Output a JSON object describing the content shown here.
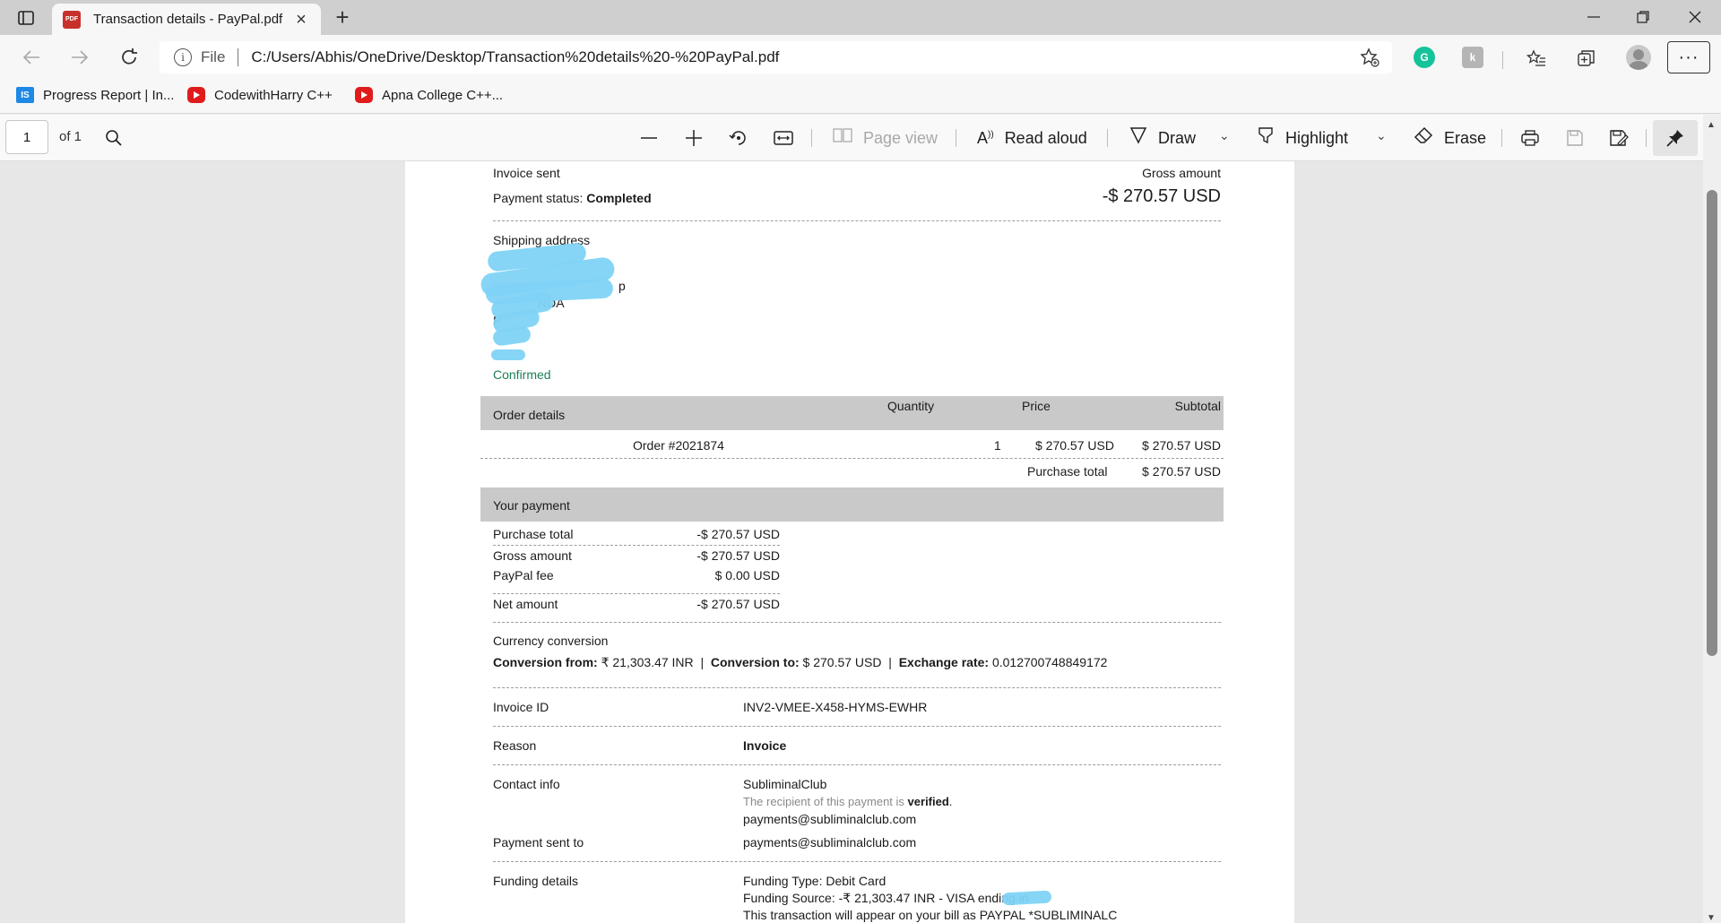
{
  "browser": {
    "tab_title": "Transaction details - PayPal.pdf",
    "tab_badge": "PDF",
    "address_scheme": "File",
    "url": "C:/Users/Abhis/OneDrive/Desktop/Transaction%20details%20-%20PayPal.pdf",
    "favorites": [
      {
        "label": "Progress Report | In...",
        "icon": "IS"
      },
      {
        "label": "CodewithHarry C++",
        "icon": "youtube"
      },
      {
        "label": "Apna College C++...",
        "icon": "youtube"
      }
    ]
  },
  "pdf_toolbar": {
    "page_number": "1",
    "page_of": "of 1",
    "page_view": "Page view",
    "read_aloud": "Read aloud",
    "draw": "Draw",
    "highlight": "Highlight",
    "erase": "Erase"
  },
  "document": {
    "invoice_sent": "Invoice sent",
    "gross_amount_label": "Gross amount",
    "payment_status_label": "Payment status:",
    "payment_status_value": "Completed",
    "gross_amount_value": "-$ 270.57 USD",
    "shipping_address_label": "Shipping address",
    "shipping_partial_1": "NDA",
    "shipping_partial_2": "P",
    "shipping_partial_3": "p",
    "confirmed": "Confirmed",
    "order_details": {
      "header": "Order details",
      "col_quantity": "Quantity",
      "col_price": "Price",
      "col_subtotal": "Subtotal",
      "item": "Order #2021874",
      "quantity": "1",
      "price": "$ 270.57 USD",
      "subtotal": "$ 270.57 USD",
      "purchase_total_label": "Purchase total",
      "purchase_total_value": "$ 270.57 USD"
    },
    "your_payment": {
      "header": "Your payment",
      "rows": [
        {
          "label": "Purchase total",
          "value": "-$ 270.57 USD"
        },
        {
          "label": "Gross amount",
          "value": "-$ 270.57 USD"
        },
        {
          "label": "PayPal fee",
          "value": "$ 0.00 USD"
        },
        {
          "label": "Net amount",
          "value": "-$ 270.57 USD"
        }
      ]
    },
    "currency_conversion": {
      "label": "Currency conversion",
      "from_label": "Conversion from:",
      "from_value": "₹ 21,303.47 INR",
      "to_label": "Conversion to:",
      "to_value": "$ 270.57 USD",
      "rate_label": "Exchange rate:",
      "rate_value": "0.012700748849172",
      "separator": "|"
    },
    "invoice_id_label": "Invoice ID",
    "invoice_id_value": "INV2-VMEE-X458-HYMS-EWHR",
    "reason_label": "Reason",
    "reason_value": "Invoice",
    "contact_info_label": "Contact info",
    "contact_name": "SubliminalClub",
    "verified_text": "The recipient of this payment is",
    "verified_word": "verified",
    "verified_period": ".",
    "contact_email": "payments@subliminalclub.com",
    "payment_sent_to_label": "Payment sent to",
    "payment_sent_to_value": "payments@subliminalclub.com",
    "funding_details_label": "Funding details",
    "funding_type": "Funding Type: Debit Card",
    "funding_source": "Funding Source: -₹ 21,303.47 INR - VISA ending in",
    "funding_bill": "This transaction will appear on your bill as PAYPAL *SUBLIMINALC"
  }
}
